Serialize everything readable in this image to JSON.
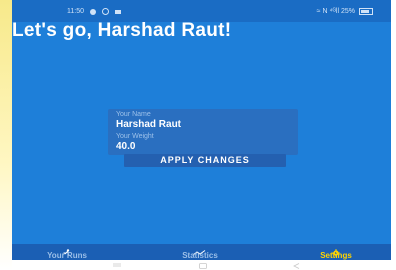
{
  "status_bar": {
    "time": "11:50",
    "right_text": "≈ N ⁴ᴳll 25%"
  },
  "header": {
    "title": "Let's go, Harshad Raut!"
  },
  "form": {
    "name_label": "Your Name",
    "name_value": "Harshad Raut",
    "weight_label": "Your Weight",
    "weight_value": "40.0",
    "apply_label": "APPLY CHANGES"
  },
  "bottom_nav": {
    "items": [
      {
        "label": "Your Runs",
        "icon": "runner-icon"
      },
      {
        "label": "Statistics",
        "icon": "trend-line-icon"
      },
      {
        "label": "Settings",
        "icon": "gear-icon",
        "active": true
      }
    ]
  },
  "colors": {
    "background": "#1e7fd9",
    "field": "#2a6fc0",
    "button": "#2460b0",
    "nav": "#1b5fb4",
    "active": "#ffd400"
  }
}
